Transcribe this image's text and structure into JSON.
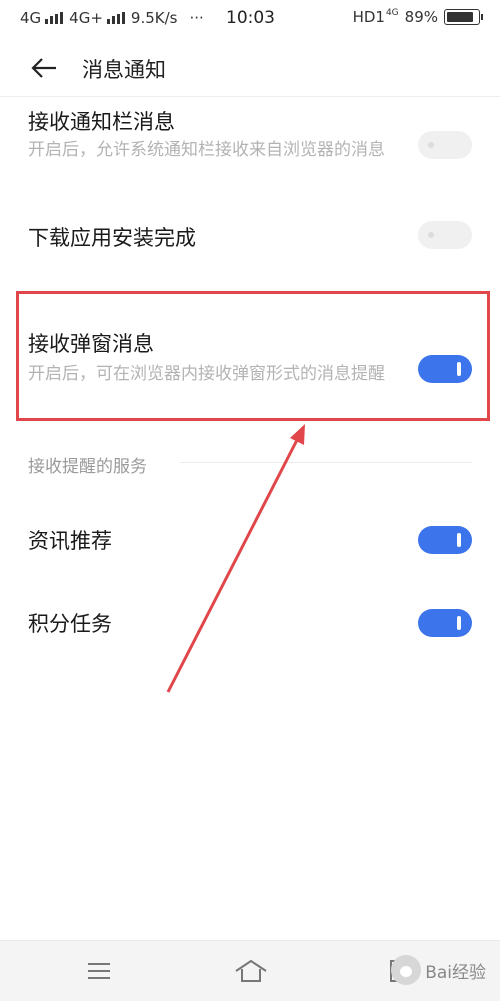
{
  "status_bar": {
    "network1": "4G",
    "network2": "4G+",
    "speed": "9.5K/s",
    "dots": "···",
    "time": "10:03",
    "hd": "HD1",
    "network3": "4G",
    "battery": "89%"
  },
  "header": {
    "title": "消息通知"
  },
  "settings": [
    {
      "title": "接收通知栏消息",
      "desc": "开启后，允许系统通知栏接收来自浏览器的消息",
      "enabled": false
    },
    {
      "title": "下载应用安装完成",
      "desc": "",
      "enabled": false
    },
    {
      "title": "接收弹窗消息",
      "desc": "开启后，可在浏览器内接收弹窗形式的消息提醒",
      "enabled": true
    }
  ],
  "section": {
    "label": "接收提醒的服务"
  },
  "services": [
    {
      "title": "资讯推荐",
      "enabled": true
    },
    {
      "title": "积分任务",
      "enabled": true
    }
  ],
  "navigation": {
    "icons": [
      "menu-icon",
      "home-icon",
      "back-nav-icon"
    ]
  },
  "watermark": {
    "text": "Bai经验"
  },
  "colors": {
    "accent": "#3c74ec",
    "annotation": "#e0464a"
  }
}
